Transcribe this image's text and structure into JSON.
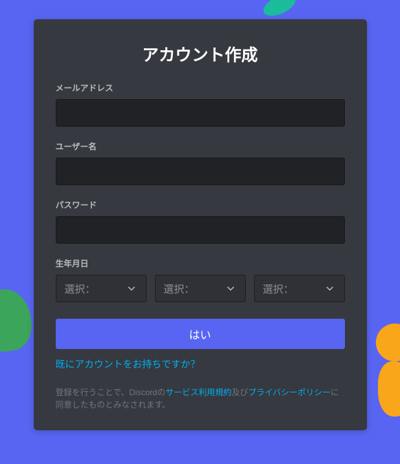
{
  "title": "アカウント作成",
  "fields": {
    "email": {
      "label": "メールアドレス",
      "value": ""
    },
    "username": {
      "label": "ユーザー名",
      "value": ""
    },
    "password": {
      "label": "パスワード",
      "value": ""
    },
    "dob": {
      "label": "生年月日",
      "month": {
        "placeholder": "選択："
      },
      "day": {
        "placeholder": "選択："
      },
      "year": {
        "placeholder": "選択："
      }
    }
  },
  "submit": "はい",
  "login_link": "既にアカウントをお持ちですか？",
  "tos": {
    "prefix": "登録を行うことで、Discordの",
    "terms": "サービス利用規約",
    "and": "及び",
    "privacy": "プライバシーポリシー",
    "suffix": "に同意したものとみなされます。"
  },
  "colors": {
    "brand": "#5865f2",
    "card": "#36393f",
    "input": "#202225",
    "link": "#00aff4"
  }
}
